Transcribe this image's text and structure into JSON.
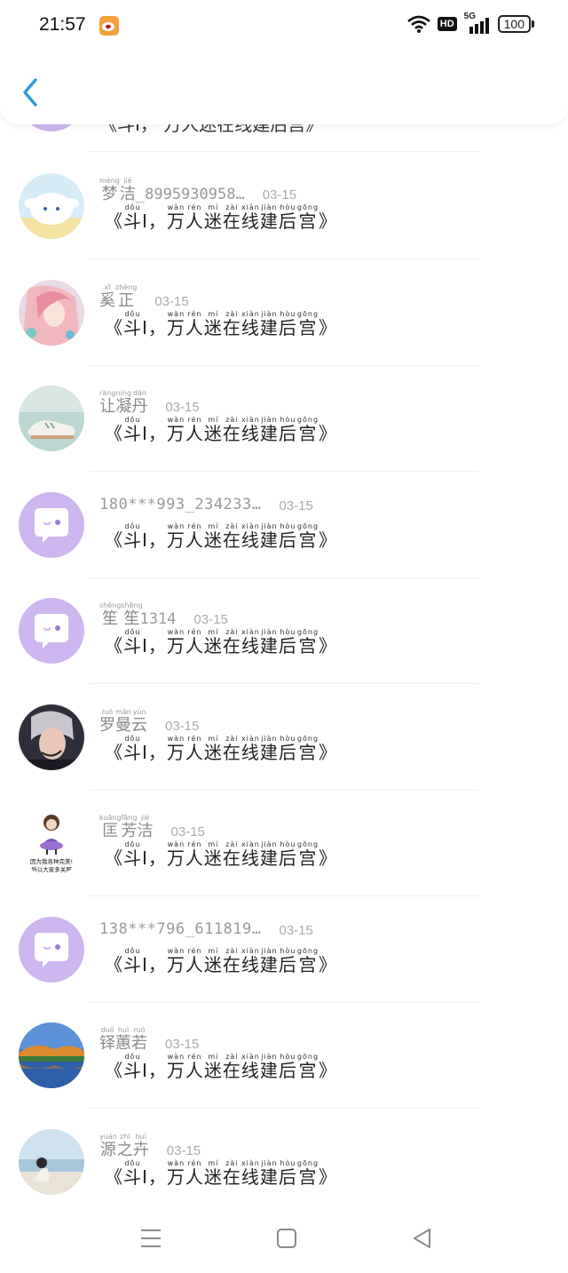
{
  "status_bar": {
    "time": "21:57",
    "hd": "HD",
    "network": "5G",
    "battery": "100"
  },
  "header": {
    "back": "‹"
  },
  "partial_row": {
    "text": "《斗I， 万人迷在线建后宫》"
  },
  "message": {
    "open": "《",
    "chars": [
      {
        "c": "斗",
        "p": "dǒu"
      },
      {
        "c": "I",
        "p": ""
      },
      {
        "c": "，",
        "p": ""
      },
      {
        "c": "万",
        "p": "wàn"
      },
      {
        "c": "人",
        "p": "rén"
      },
      {
        "c": "迷",
        "p": "mí"
      },
      {
        "c": "在",
        "p": "zài"
      },
      {
        "c": "线",
        "p": "xiàn"
      },
      {
        "c": "建",
        "p": "jiàn"
      },
      {
        "c": "后",
        "p": "hòu"
      },
      {
        "c": "宫",
        "p": "gōng"
      }
    ],
    "close": "》"
  },
  "rows": [
    {
      "name": "梦洁_8995930958…",
      "name_ruby": [
        {
          "c": "梦",
          "p": "mèng"
        },
        {
          "c": "洁",
          "p": "jié"
        }
      ],
      "name_rest": "_8995930958…",
      "date": "03-15",
      "avatar": "cinnamoroll-avatar"
    },
    {
      "name": "奚正",
      "name_ruby": [
        {
          "c": "奚",
          "p": "xī"
        },
        {
          "c": "正",
          "p": "zhèng"
        }
      ],
      "name_rest": "",
      "date": "03-15",
      "avatar": "anime-girl-avatar"
    },
    {
      "name": "让凝丹",
      "name_ruby": [
        {
          "c": "让",
          "p": "ràng"
        },
        {
          "c": "凝",
          "p": "níng"
        },
        {
          "c": "丹",
          "p": "dān"
        }
      ],
      "name_rest": "",
      "date": "03-15",
      "avatar": "sneakers-avatar"
    },
    {
      "name": "180***993_234233…",
      "name_ruby": [],
      "name_rest": "180***993_234233…",
      "date": "03-15",
      "avatar": "default-chat-avatar"
    },
    {
      "name": "笙笙1314",
      "name_ruby": [
        {
          "c": "笙笙",
          "p": "shēngshēng"
        }
      ],
      "name_rest": "1314",
      "date": "03-15",
      "avatar": "default-chat-avatar"
    },
    {
      "name": "罗曼云",
      "name_ruby": [
        {
          "c": "罗",
          "p": "luó"
        },
        {
          "c": "曼",
          "p": "màn"
        },
        {
          "c": "云",
          "p": "yún"
        }
      ],
      "name_rest": "",
      "date": "03-15",
      "avatar": "singer-avatar"
    },
    {
      "name": "匡芳洁",
      "name_ruby": [
        {
          "c": "匡",
          "p": "kuāng"
        },
        {
          "c": "芳",
          "p": "fāng"
        },
        {
          "c": "洁",
          "p": "jié"
        }
      ],
      "name_rest": "",
      "date": "03-15",
      "avatar": "cartoon-girl-avatar",
      "avatar_caption": [
        "因为我各种完美!",
        "所以大家多关照"
      ]
    },
    {
      "name": "138***796_611819…",
      "name_ruby": [],
      "name_rest": "138***796_611819…",
      "date": "03-15",
      "avatar": "default-chat-avatar"
    },
    {
      "name": "铎蕙若",
      "name_ruby": [
        {
          "c": "铎",
          "p": "duó"
        },
        {
          "c": "蕙",
          "p": "huì"
        },
        {
          "c": "若",
          "p": "ruò"
        }
      ],
      "name_rest": "",
      "date": "03-15",
      "avatar": "lake-landscape-avatar"
    },
    {
      "name": "源之卉",
      "name_ruby": [
        {
          "c": "源",
          "p": "yuán"
        },
        {
          "c": "之",
          "p": "zhī"
        },
        {
          "c": "卉",
          "p": "huì"
        }
      ],
      "name_rest": "",
      "date": "03-15",
      "avatar": "beach-girl-avatar"
    }
  ],
  "colors": {
    "default_avatar": "#cdb5ef",
    "divider": "#efefef",
    "date": "#aaaaaa",
    "back_arrow": "#2f9ad8"
  },
  "navbar": {
    "menu_icon": "menu-icon",
    "home_icon": "home-icon",
    "back_icon": "back-triangle-icon"
  }
}
